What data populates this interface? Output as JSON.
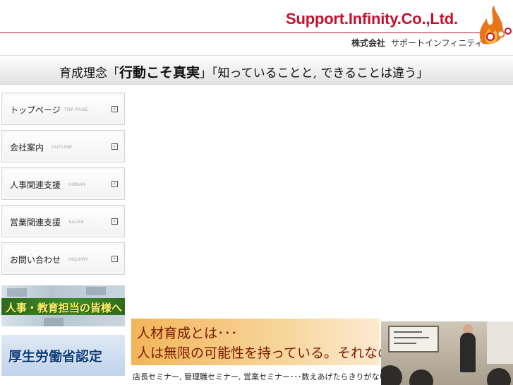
{
  "header": {
    "logo_text": "Support.Infinity.Co.,Ltd.",
    "company_prefix": "株式会社",
    "company_name": "サポートインフィニティ",
    "accent_color": "#c8102e"
  },
  "slogan": {
    "part1": "育成理念「",
    "part2": "行動こそ真実",
    "part3": "」「知っていることと, できることは違う」"
  },
  "nav": [
    {
      "label": "トップページ",
      "sub": "TOP PAGE"
    },
    {
      "label": "会社案内",
      "sub": "OUTLINE"
    },
    {
      "label": "人事関連支援",
      "sub": "HUMAN"
    },
    {
      "label": "営業関連支援",
      "sub": "SALES"
    },
    {
      "label": "お問い合わせ",
      "sub": "INQUIRY"
    }
  ],
  "banners": {
    "hr": "人事・教育担当の皆様へ",
    "ministry": "厚生労働省認定"
  },
  "promo": {
    "line1": "人材育成とは･･･",
    "line2": "人は無限の可能性を持っている。それなのになぜ･･･。",
    "sub": "店長セミナー, 管理職セミナー, 営業セミナー･･･数えあげたらきりがない。"
  }
}
